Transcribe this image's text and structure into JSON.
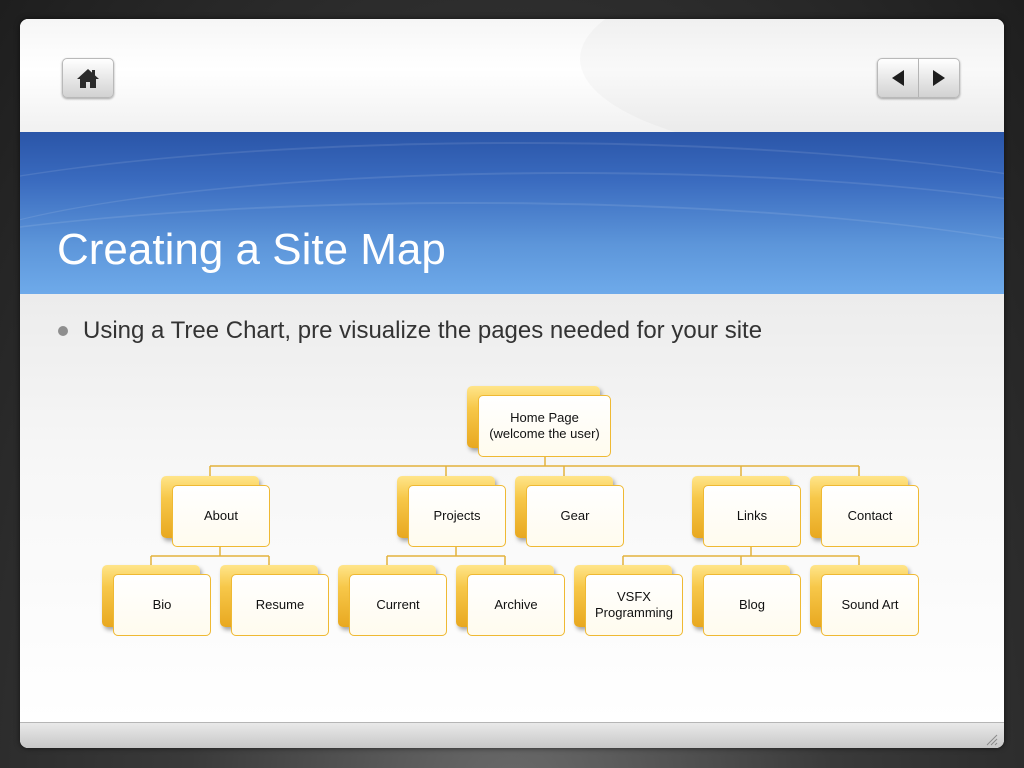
{
  "slide": {
    "title": "Creating a Site Map",
    "bullet": "Using a Tree Chart, pre visualize the pages needed for your site"
  },
  "nav": {
    "home_icon": "home-icon",
    "prev_icon": "triangle-left-icon",
    "next_icon": "triangle-right-icon"
  },
  "tree": {
    "root": "Home Page\n(welcome the user)",
    "level1": [
      "About",
      "Projects",
      "Gear",
      "Links",
      "Contact"
    ],
    "level2": [
      "Bio",
      "Resume",
      "Current",
      "Archive",
      "VSFX Programming",
      "Blog",
      "Sound Art"
    ]
  },
  "colors": {
    "title_band": "#3a6bbf",
    "node_back": "#f7c84a",
    "node_border": "#efb933",
    "connector": "#e3b23c"
  }
}
